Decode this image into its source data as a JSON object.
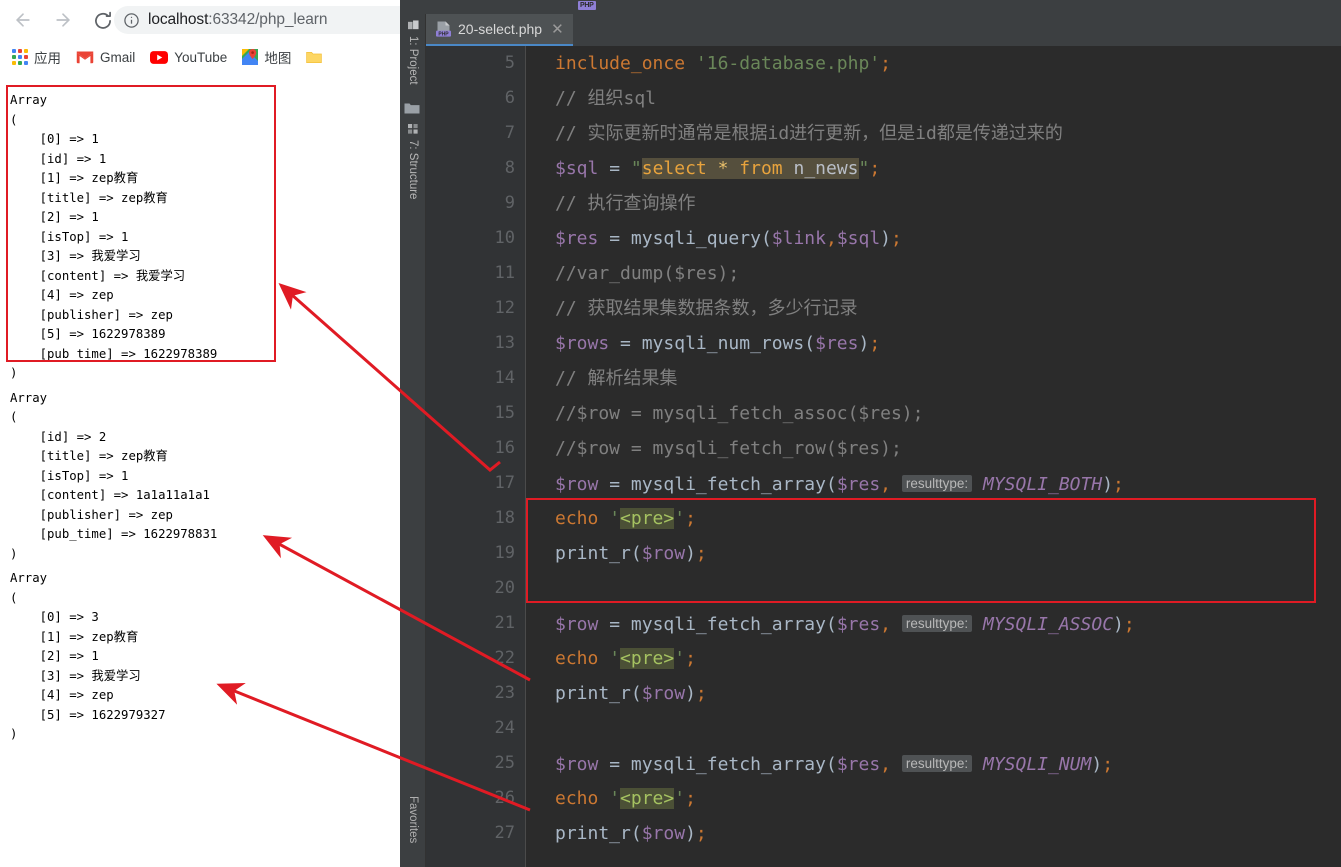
{
  "browser": {
    "nav": {
      "back_label": "Back",
      "forward_label": "Forward",
      "reload_label": "Reload"
    },
    "omnibox": {
      "info_icon": "info-circle-icon",
      "url_visible": "localhost:63342/php_learn",
      "url_host": "localhost",
      "url_rest": ":63342/php_learn"
    },
    "bookmarks": [
      {
        "icon": "apps-grid-icon",
        "label": "应用"
      },
      {
        "icon": "gmail-icon",
        "label": "Gmail"
      },
      {
        "icon": "youtube-icon",
        "label": "YouTube"
      },
      {
        "icon": "google-maps-icon",
        "label": "地图"
      },
      {
        "icon": "folder-icon",
        "label": ""
      }
    ],
    "output": {
      "block1": "Array\n(\n    [0] => 1\n    [id] => 1\n    [1] => zep教育\n    [title] => zep教育\n    [2] => 1\n    [isTop] => 1\n    [3] => 我爱学习\n    [content] => 我爱学习\n    [4] => zep\n    [publisher] => zep\n    [5] => 1622978389\n    [pub_time] => 1622978389\n)",
      "block2": "Array\n(\n    [id] => 2\n    [title] => zep教育\n    [isTop] => 1\n    [content] => 1a1a11a1a1\n    [publisher] => zep\n    [pub_time] => 1622978831\n)",
      "block3": "Array\n(\n    [0] => 3\n    [1] => zep教育\n    [2] => 1\n    [3] => 我爱学习\n    [4] => zep\n    [5] => 1622979327\n)"
    }
  },
  "ide": {
    "toolwindows": {
      "project": "1: Project",
      "structure": "7: Structure",
      "favorites": "Favorites"
    },
    "tab": {
      "label": "20-select.php",
      "icon": "php-file-icon",
      "close_icon": "close-icon"
    },
    "gutter_lines": [
      "5",
      "6",
      "7",
      "8",
      "9",
      "10",
      "11",
      "12",
      "13",
      "14",
      "15",
      "16",
      "17",
      "18",
      "19",
      "20",
      "21",
      "22",
      "23",
      "24",
      "25",
      "26",
      "27"
    ],
    "code": {
      "l5_kw": "include_once",
      "l5_str": "'16-database.php'",
      "l6": "// 组织sql",
      "l7": "// 实际更新时通常是根据id进行更新，但是id都是传递过来的",
      "l8_var": "$sql",
      "l8_sql": "select * from n_news",
      "l9": "// 执行查询操作",
      "l10_var": "$res",
      "l10_fn": "mysqli_query",
      "l10_a1": "$link",
      "l10_a2": "$sql",
      "l11": "//var_dump($res);",
      "l12": "// 获取结果集数据条数，多少行记录",
      "l13_var": "$rows",
      "l13_fn": "mysqli_num_rows",
      "l13_a1": "$res",
      "l14": "// 解析结果集",
      "l15": "//$row = mysqli_fetch_assoc($res);",
      "l16": "//$row = mysqli_fetch_row($res);",
      "row_var": "$row",
      "fetch_array": "mysqli_fetch_array",
      "arg_res": "$res",
      "hint_label": "resulttype:",
      "const_both": "MYSQLI_BOTH",
      "const_assoc": "MYSQLI_ASSOC",
      "const_num": "MYSQLI_NUM",
      "echo_kw": "echo",
      "pre_str": "<pre>",
      "printr": "print_r"
    }
  },
  "annotations": {
    "color": "#e01b24",
    "arrow_count": 3,
    "boxes": [
      "output-array-both",
      "code-lines-17-19"
    ]
  }
}
